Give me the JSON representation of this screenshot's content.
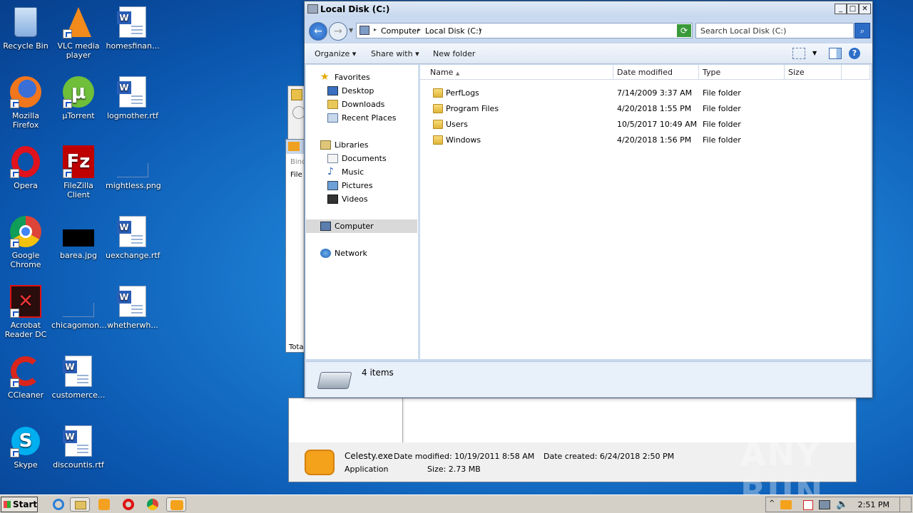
{
  "desktop": {
    "icons": [
      {
        "label": "Recycle Bin"
      },
      {
        "label": "VLC media player"
      },
      {
        "label": "homesfinan..."
      },
      {
        "label": "Mozilla Firefox"
      },
      {
        "label": "µTorrent"
      },
      {
        "label": "logmother.rtf"
      },
      {
        "label": "Opera"
      },
      {
        "label": "FileZilla Client"
      },
      {
        "label": "mightless.png"
      },
      {
        "label": "Google Chrome"
      },
      {
        "label": "barea.jpg"
      },
      {
        "label": "uexchange.rtf"
      },
      {
        "label": "Acrobat Reader DC"
      },
      {
        "label": "chicagomon..."
      },
      {
        "label": "whetherwh..."
      },
      {
        "label": "CCleaner"
      },
      {
        "label": "customerce..."
      },
      {
        "label": "Skype"
      },
      {
        "label": "discountis.rtf"
      }
    ]
  },
  "explorer": {
    "title": "Local Disk (C:)",
    "breadcrumb": [
      "Computer",
      "Local Disk (C:)"
    ],
    "search_placeholder": "Search Local Disk (C:)",
    "commands": {
      "organize": "Organize",
      "share": "Share with",
      "newfolder": "New folder"
    },
    "nav": {
      "favorites": "Favorites",
      "desktop": "Desktop",
      "downloads": "Downloads",
      "recent": "Recent Places",
      "libraries": "Libraries",
      "documents": "Documents",
      "music": "Music",
      "pictures": "Pictures",
      "videos": "Videos",
      "computer": "Computer",
      "network": "Network"
    },
    "columns": {
      "name": "Name",
      "date": "Date modified",
      "type": "Type",
      "size": "Size"
    },
    "files": [
      {
        "name": "PerfLogs",
        "date": "7/14/2009 3:37 AM",
        "type": "File folder"
      },
      {
        "name": "Program Files",
        "date": "4/20/2018 1:55 PM",
        "type": "File folder"
      },
      {
        "name": "Users",
        "date": "10/5/2017 10:49 AM",
        "type": "File folder"
      },
      {
        "name": "Windows",
        "date": "4/20/2018 1:56 PM",
        "type": "File folder"
      }
    ],
    "status": "4 items"
  },
  "bg_window": {
    "file_name": "Celesty.exe",
    "modified_label": "Date modified: 10/19/2011 8:58 AM",
    "created_label": "Date created: 6/24/2018 2:50 PM",
    "type": "Application",
    "size": "Size: 2.73 MB",
    "partial_labels": {
      "bind": "Bind",
      "file": "File",
      "total": "Tota"
    }
  },
  "taskbar": {
    "start": "Start",
    "clock": "2:51 PM"
  },
  "watermark": "ANY RUN"
}
